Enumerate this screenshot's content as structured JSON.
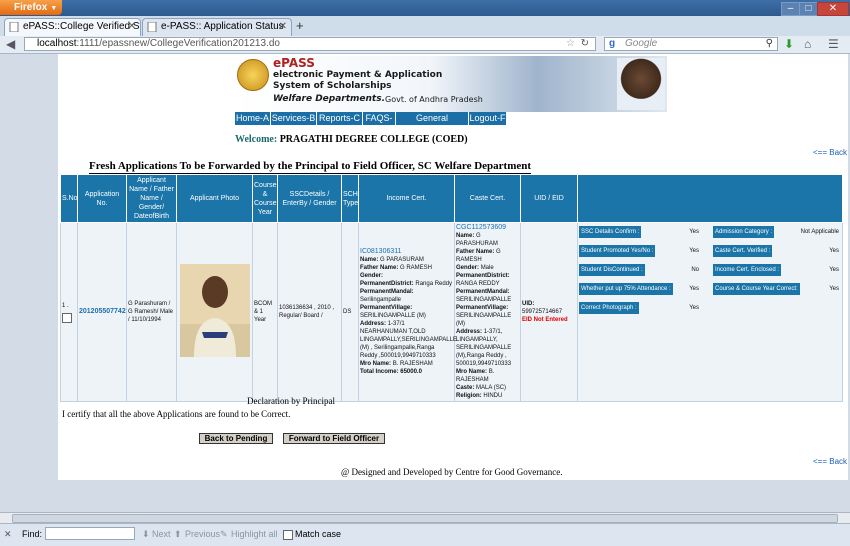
{
  "browser": {
    "app_button": "Firefox",
    "tabs": [
      {
        "label": "ePASS::College Verified Stud..."
      },
      {
        "label": "e-PASS:: Application Status"
      }
    ],
    "new_tab": "+",
    "url_host": "localhost",
    "url_rest": ":1111/epassnew/CollegeVerification201213.do",
    "search_placeholder": "Google"
  },
  "banner": {
    "brand": "ePASS",
    "line1": "electronic Payment & Application",
    "line2": "System of Scholarships",
    "line3": "Welfare Departments.",
    "line3b": "Govt. of Andhra Pradesh"
  },
  "menu": [
    {
      "label": "Home-A"
    },
    {
      "label": "Services-B"
    },
    {
      "label": "Reports-C"
    },
    {
      "label": "FAQS-D"
    },
    {
      "label": "General Services-E"
    },
    {
      "label": "Logout-F"
    }
  ],
  "welcome": {
    "label": "Welcome:",
    "college": "PRAGATHI DEGREE COLLEGE (COED)"
  },
  "back_link": "<== Back",
  "heading": "Fresh Applications To be Forwarded by the Principal to Field Officer, SC Welfare Department",
  "table": {
    "headers": [
      "S.No",
      "Application No.",
      "Applicant Name / Father Name / Gender/ DateofBirth",
      "Applicant Photo",
      "Course & Course Year",
      "SSCDetails / EnterBy / Gender",
      "SCH Type",
      "Income Cert.",
      "Caste Cert.",
      "UID / EID",
      ""
    ],
    "row": {
      "sno": "1 .",
      "app_no": "201205507742",
      "applicant": "G Parashuram / G Ramesh/ Male / 11/10/1994",
      "course": "BCOM & 1 Year",
      "ssc": "1036136634 , 2010 , Regular/ Board /",
      "sch_type": "DS",
      "income": {
        "cert_no": "IC081306311",
        "name_label": "Name:",
        "name": "G PARASURAM",
        "father_label": "Father Name:",
        "father": "G RAMESH",
        "gender_label": "Gender:",
        "district_label": "PermanentDistrict:",
        "district": "Ranga Reddy",
        "mandal_label": "PermanentMandal:",
        "mandal": "Serilingampalle",
        "village_label": "PermanentVillage:",
        "village": "SERILINGAMPALLE (M)",
        "address_label": "Address:",
        "address": "1-37/1 NEARHANUMAN T,OLD LINGAMPALLY,SERILINGAMPALLE (M) , Serilingampalle,Ranga Reddy ,500019,9949710333",
        "mro_label": "Mro Name:",
        "mro": "B. RAJESHAM",
        "total_label": "Total Income:",
        "total": "65000.0"
      },
      "caste": {
        "cert_no": "CGC112573609",
        "name_label": "Name:",
        "name": "G PARASHURAM",
        "father_label": "Father Name:",
        "father": "G RAMESH",
        "gender_label": "Gender:",
        "gender": "Male",
        "district_label": "PermanentDistrict:",
        "district": "RANGA REDDY",
        "mandal_label": "PermanentMandal:",
        "mandal": "SERILINGAMPALLE",
        "village_label": "PermanentVillage:",
        "village": "SERILINGAMPALLE (M)",
        "address_label": "Address:",
        "address": "1-37/1, LINGAMPALLY, SERILINGAMPALLE (M),Ranga Reddy , 500019,9949710333",
        "mro_label": "Mro Name:",
        "mro": "B. RAJESHAM",
        "caste_label": "Caste:",
        "caste": "MALA (SC)",
        "religion_label": "Religion:",
        "religion": "HINDU"
      },
      "uid_label": "UID:",
      "uid": "599725714667",
      "eid": "EID Not Entered",
      "checks_left": [
        {
          "label": "SSC Details Confirm :",
          "value": "Yes"
        },
        {
          "label": "Student Promoted Yes/No :",
          "value": "Yes"
        },
        {
          "label": "Student DisContinued :",
          "value": "No"
        },
        {
          "label": "Whether put up 75% Attendance :",
          "value": "Yes"
        },
        {
          "label": "Correct Photograph :",
          "value": "Yes"
        }
      ],
      "checks_right": [
        {
          "label": "Admission Category :",
          "value": "Not Applicable"
        },
        {
          "label": "Caste Cert. Verified :",
          "value": "Yes"
        },
        {
          "label": "Income Cert. Enclosed :",
          "value": "Yes"
        },
        {
          "label": "Course & Course Year Correct:",
          "value": "Yes"
        }
      ]
    }
  },
  "declaration": "Declaration by Principal",
  "certify": "I certify that all the above Applications are found to be Correct.",
  "buttons": {
    "back": "Back to Pending",
    "forward": "Forward to Field Officer"
  },
  "footer": "@ Designed and Developed by Centre for Good Governance.",
  "findbar": {
    "find_label": "Find:",
    "next": "Next",
    "previous": "Previous",
    "highlight": "Highlight all",
    "match_case": "Match case"
  }
}
